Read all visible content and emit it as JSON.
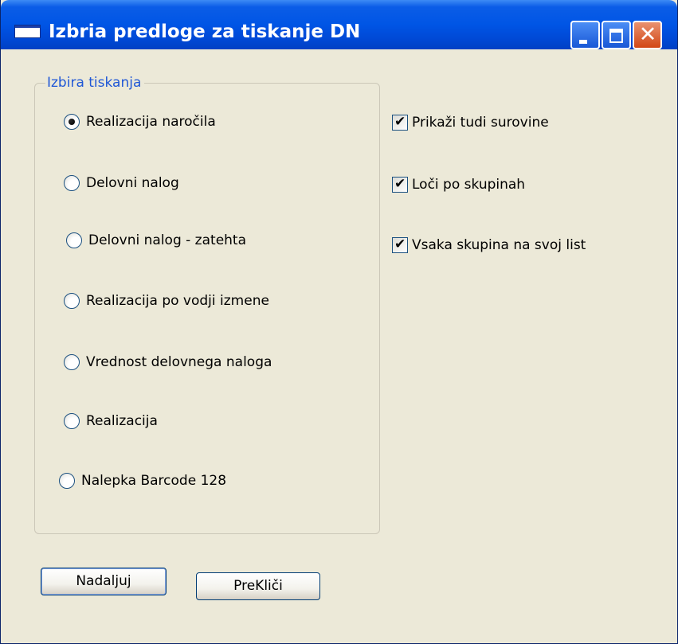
{
  "window": {
    "title": "Izbria predloge za tiskanje DN",
    "controls": {
      "minimize_icon": "minimize-icon",
      "maximize_icon": "maximize-icon",
      "close_icon": "close-icon",
      "close_glyph": "✕"
    }
  },
  "group": {
    "legend": "Izbira tiskanja",
    "options": [
      {
        "label": "Realizacija naročila",
        "selected": true
      },
      {
        "label": "Delovni nalog",
        "selected": false
      },
      {
        "label": "Delovni nalog - zatehta",
        "selected": false
      },
      {
        "label": "Realizacija po vodji izmene",
        "selected": false
      },
      {
        "label": "Vrednost delovnega naloga",
        "selected": false
      },
      {
        "label": "Realizacija",
        "selected": false
      },
      {
        "label": "Nalepka Barcode 128",
        "selected": false
      }
    ]
  },
  "checkboxes": [
    {
      "label": "Prikaži tudi surovine",
      "checked": true
    },
    {
      "label": "Loči po skupinah",
      "checked": true
    },
    {
      "label": "Vsaka skupina na svoj list",
      "checked": true
    }
  ],
  "check_glyph": "✔",
  "buttons": {
    "continue_label": "Nadaljuj",
    "cancel_label": "PreKliči"
  },
  "colors": {
    "titlebar": "#0055e5",
    "window_bg": "#ece9d8",
    "legend_text": "#1f57d6",
    "close_button": "#d24615"
  }
}
